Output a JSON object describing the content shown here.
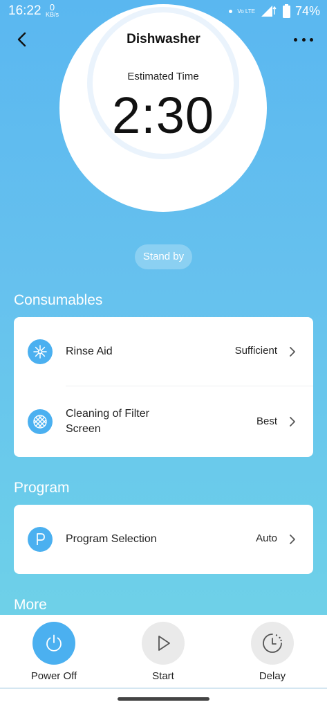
{
  "status_bar": {
    "time": "16:22",
    "speed_value": "0",
    "speed_unit": "KB/s",
    "network": "Vo LTE",
    "battery": "74%"
  },
  "app_bar": {
    "title": "Dishwasher",
    "back_icon": "chevron-left-icon",
    "more_icon": "more-horizontal-icon"
  },
  "dial": {
    "label": "Estimated Time",
    "time": "2:30"
  },
  "status_chip": "Stand by",
  "consumables": {
    "title": "Consumables",
    "items": [
      {
        "icon": "rinse-aid-icon",
        "label": "Rinse Aid",
        "value": "Sufficient"
      },
      {
        "icon": "filter-screen-icon",
        "label": "Cleaning of Filter Screen",
        "value": "Best"
      }
    ]
  },
  "program": {
    "title": "Program",
    "items": [
      {
        "icon": "program-p-icon",
        "label": "Program Selection",
        "value": "Auto"
      }
    ]
  },
  "more": {
    "title": "More"
  },
  "actions": [
    {
      "icon": "power-icon",
      "label": "Power Off",
      "active": true,
      "color": "#4bb0f0"
    },
    {
      "icon": "play-icon",
      "label": "Start",
      "active": false
    },
    {
      "icon": "timer-icon",
      "label": "Delay",
      "active": false
    }
  ],
  "colors": {
    "accent": "#4bb0f0",
    "background_top": "#5ab7f0",
    "background_bottom": "#72d4e6"
  }
}
